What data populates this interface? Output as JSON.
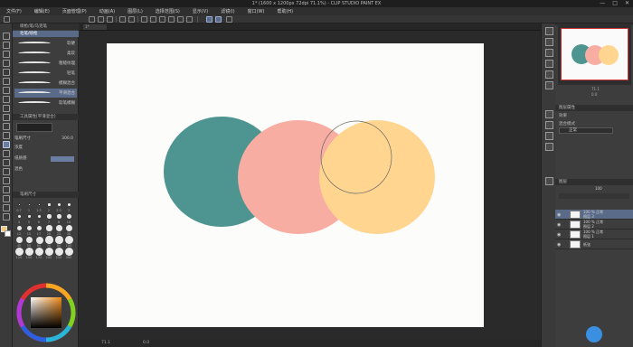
{
  "window": {
    "title": "1* (1600 x 1200px 72dpi 71.1%) - CLIP STUDIO PAINT EX",
    "controls": [
      "—",
      "□",
      "✕"
    ]
  },
  "menu": [
    "文件(F)",
    "编辑(E)",
    "页面管理(P)",
    "动画(A)",
    "图层(L)",
    "选择范围(S)",
    "显示(V)",
    "滤镜(I)",
    "窗口(W)",
    "帮助(H)"
  ],
  "doc_tab": "1*",
  "left_panel": {
    "brush_header": "喷枪/笔/马克笔",
    "brush_selected": "毛笔/喷枪",
    "brushes": [
      "软硬",
      "柔软",
      "粗糙纹理",
      "轻笔",
      "模糊混合",
      "平滑混合",
      "软笔模糊"
    ],
    "tool_property_header": "工具属性[平滑混合]",
    "brush_size_label": "笔刷尺寸",
    "brush_size_value": "300.0",
    "density_label": "浓度",
    "texture_label": "纸质感",
    "blend_label": "混色",
    "brush_size_panel_header": "笔刷尺寸",
    "size_labels": [
      "0.7",
      "1",
      "1.5",
      "2",
      "2.5",
      "3",
      "4",
      "5",
      "6",
      "7",
      "8",
      "10",
      "12",
      "15",
      "17",
      "20",
      "25",
      "30",
      "40",
      "50",
      "60",
      "70",
      "80",
      "100",
      "120",
      "150",
      "170",
      "200",
      "250",
      "300"
    ]
  },
  "right_panel": {
    "navigator_header": "导航器",
    "navigator_zoom": "71.1",
    "navigator_angle": "0.0",
    "layer_property_header": "图层属性",
    "layer_property_label": "效果",
    "blend_mode_label": "混合模式",
    "blend_mode_value": "正常",
    "layer_header": "图层",
    "opacity_value": "100",
    "layers": [
      {
        "percent": "100 %",
        "mode": "正常",
        "name": "图层 3",
        "selected": true
      },
      {
        "percent": "100 %",
        "mode": "正常",
        "name": "图层 2",
        "selected": false
      },
      {
        "percent": "100 %",
        "mode": "正常",
        "name": "图层 1",
        "selected": false
      },
      {
        "percent": "",
        "mode": "",
        "name": "纸张",
        "selected": false
      }
    ]
  },
  "status": {
    "zoom": "71.1",
    "angle": "0.0"
  },
  "colors": {
    "teal": "#4e9490",
    "pink": "#f7ada2",
    "peach": "#ffd590",
    "main_color": "#f5c97a",
    "sub_color": "#ffffff",
    "accent": "#5a6b8a"
  },
  "icons": [
    "pen-icon",
    "eraser-icon",
    "fill-icon",
    "move-icon",
    "zoom-icon",
    "lasso-icon",
    "eyedropper-icon",
    "text-icon",
    "gradient-icon",
    "color-wheel-icon",
    "eye-icon"
  ]
}
